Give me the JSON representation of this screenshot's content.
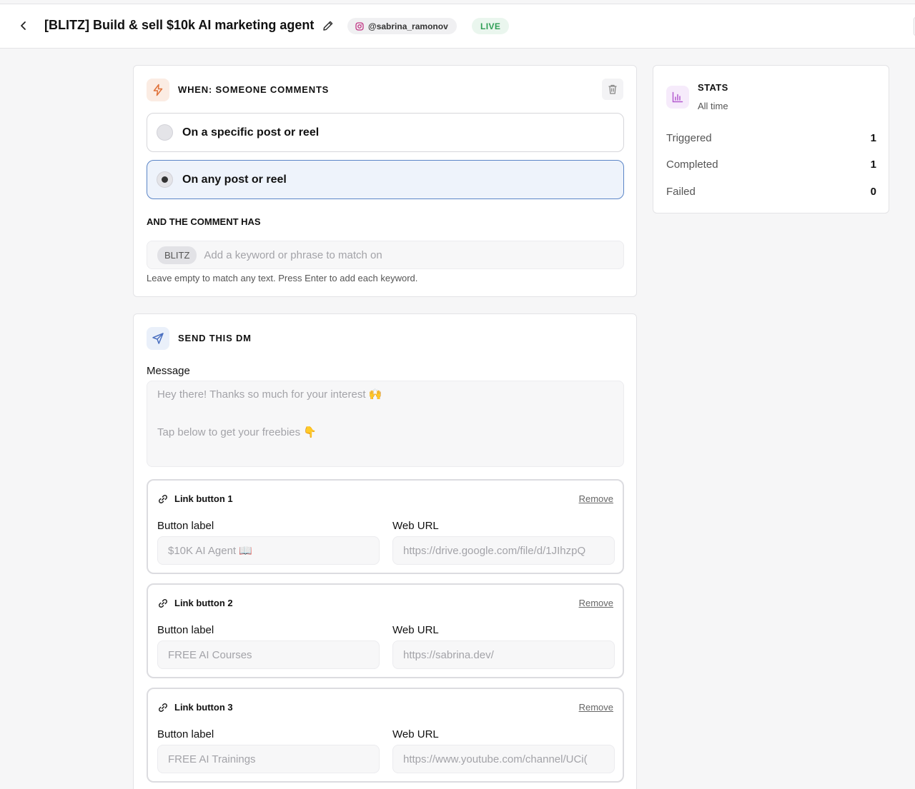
{
  "header": {
    "title": "[BLITZ] Build & sell $10k AI marketing agent",
    "account": "@sabrina_ramonov",
    "status": "LIVE"
  },
  "trigger": {
    "title": "WHEN: SOMEONE COMMENTS",
    "options": [
      {
        "label": "On a specific post or reel",
        "selected": false
      },
      {
        "label": "On any post or reel",
        "selected": true
      }
    ],
    "comment_label": "AND THE COMMENT HAS",
    "keywords": [
      "BLITZ"
    ],
    "keyword_placeholder": "Add a keyword or phrase to match on",
    "help": "Leave empty to match any text. Press Enter to add each keyword."
  },
  "dm": {
    "title": "SEND THIS DM",
    "message_label": "Message",
    "message_lines": [
      "Hey there! Thanks so much for your interest 🙌",
      "Tap below to get your freebies 👇"
    ],
    "link_buttons": [
      {
        "title": "Link button 1",
        "remove": "Remove",
        "label_caption": "Button label",
        "url_caption": "Web URL",
        "label": "$10K AI Agent 📖",
        "url": "https://drive.google.com/file/d/1JIhzpQ"
      },
      {
        "title": "Link button 2",
        "remove": "Remove",
        "label_caption": "Button label",
        "url_caption": "Web URL",
        "label": "FREE AI Courses",
        "url": "https://sabrina.dev/"
      },
      {
        "title": "Link button 3",
        "remove": "Remove",
        "label_caption": "Button label",
        "url_caption": "Web URL",
        "label": "FREE AI Trainings",
        "url": "https://www.youtube.com/channel/UCi("
      }
    ]
  },
  "stats": {
    "title": "STATS",
    "period": "All time",
    "rows": [
      {
        "name": "Triggered",
        "value": "1"
      },
      {
        "name": "Completed",
        "value": "1"
      },
      {
        "name": "Failed",
        "value": "0"
      }
    ]
  },
  "colors": {
    "trigger_icon": "#e0723a",
    "dm_icon": "#4a6fc0",
    "stats_icon": "#b35bd0",
    "live": "#2f9e55",
    "selected_border": "#5b85c7"
  }
}
